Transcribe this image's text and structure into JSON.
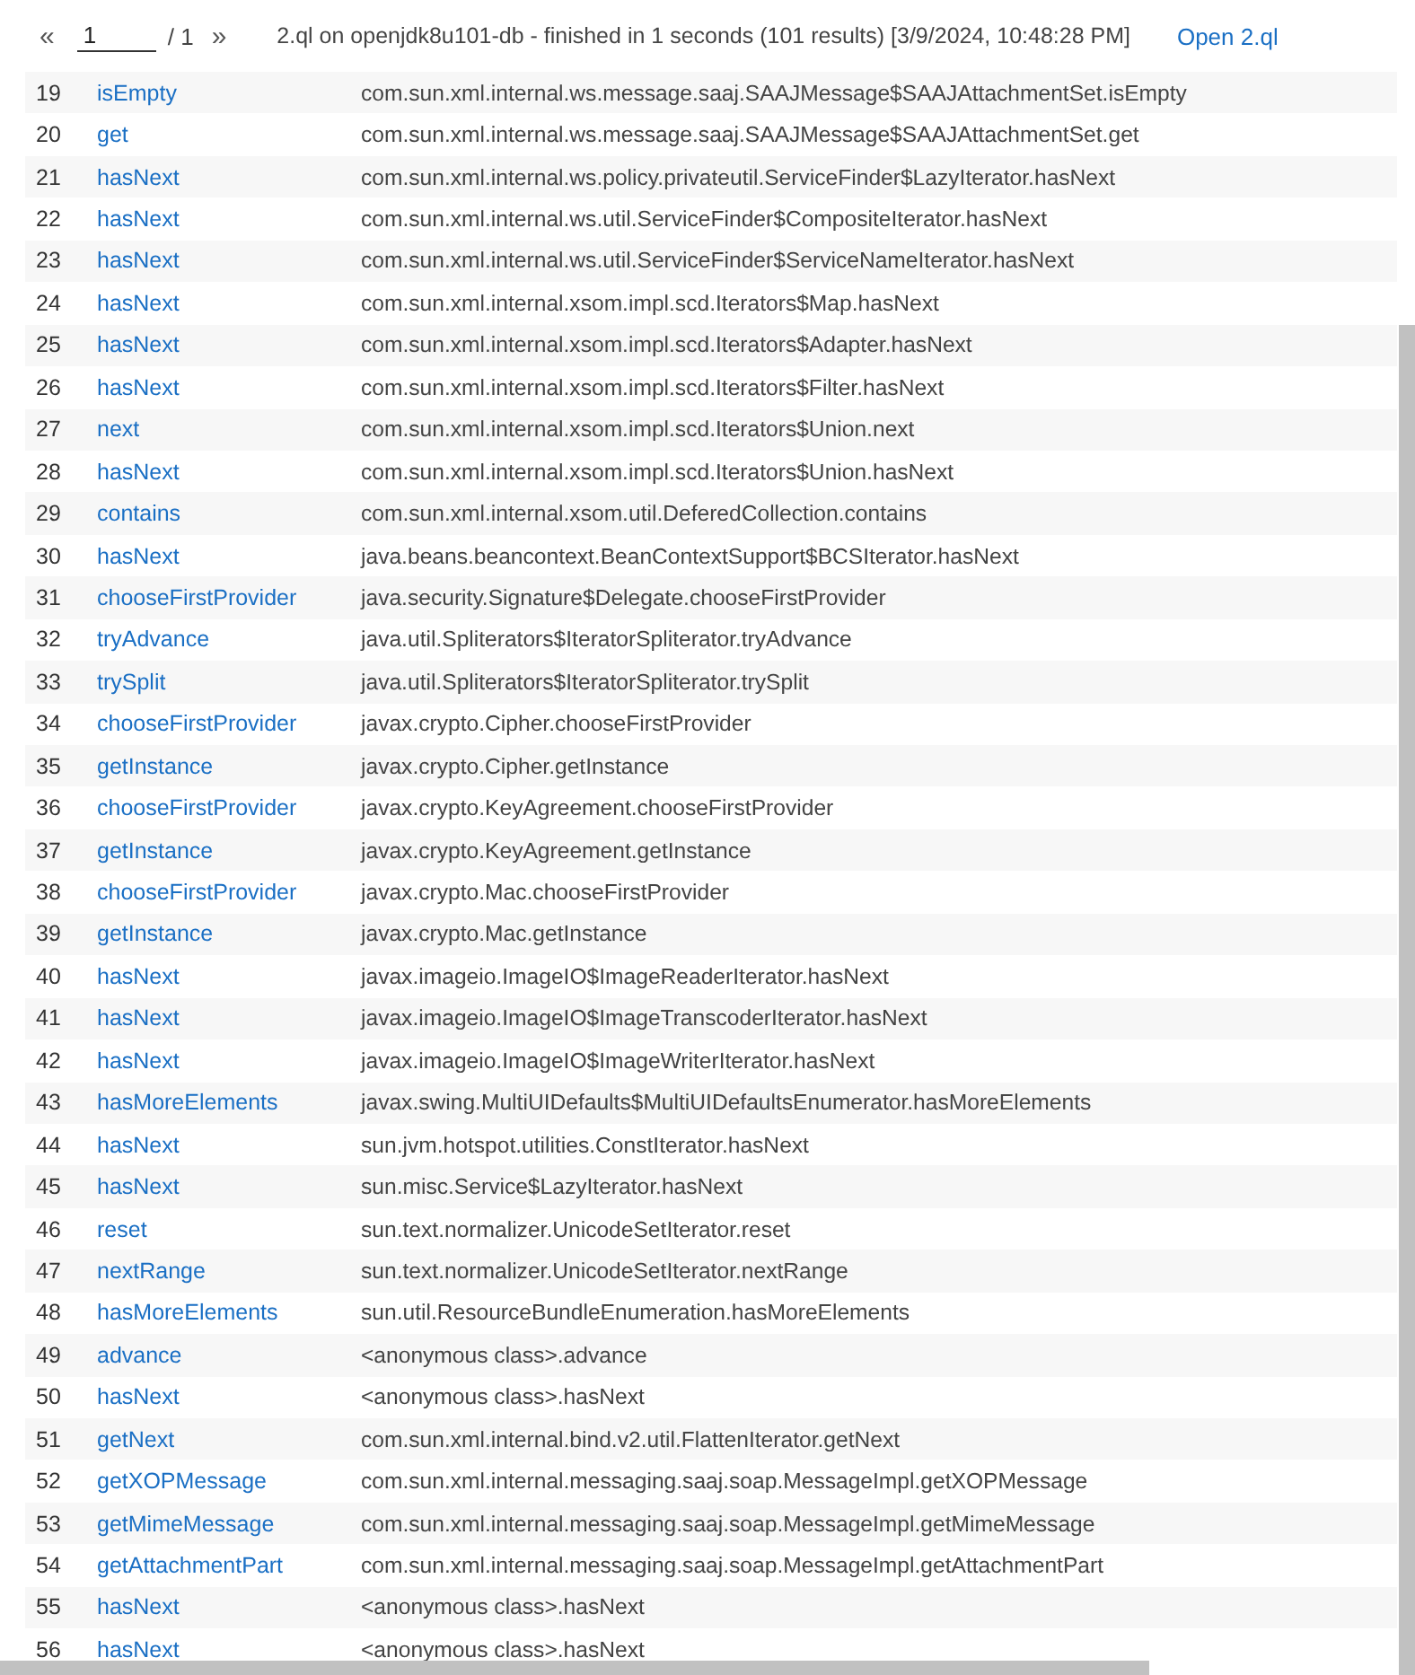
{
  "pager": {
    "prev": "«",
    "page": "1",
    "total": "/ 1",
    "next": "»"
  },
  "summary": "2.ql on openjdk8u101-db - finished in 1 seconds (101 results) [3/9/2024, 10:48:28 PM]",
  "open_link": "Open 2.ql",
  "rows": [
    {
      "index": "19",
      "name": "isEmpty",
      "path": "com.sun.xml.internal.ws.message.saaj.SAAJMessage$SAAJAttachmentSet.isEmpty"
    },
    {
      "index": "20",
      "name": "get",
      "path": "com.sun.xml.internal.ws.message.saaj.SAAJMessage$SAAJAttachmentSet.get"
    },
    {
      "index": "21",
      "name": "hasNext",
      "path": "com.sun.xml.internal.ws.policy.privateutil.ServiceFinder$LazyIterator.hasNext"
    },
    {
      "index": "22",
      "name": "hasNext",
      "path": "com.sun.xml.internal.ws.util.ServiceFinder$CompositeIterator.hasNext"
    },
    {
      "index": "23",
      "name": "hasNext",
      "path": "com.sun.xml.internal.ws.util.ServiceFinder$ServiceNameIterator.hasNext"
    },
    {
      "index": "24",
      "name": "hasNext",
      "path": "com.sun.xml.internal.xsom.impl.scd.Iterators$Map.hasNext"
    },
    {
      "index": "25",
      "name": "hasNext",
      "path": "com.sun.xml.internal.xsom.impl.scd.Iterators$Adapter.hasNext"
    },
    {
      "index": "26",
      "name": "hasNext",
      "path": "com.sun.xml.internal.xsom.impl.scd.Iterators$Filter.hasNext"
    },
    {
      "index": "27",
      "name": "next",
      "path": "com.sun.xml.internal.xsom.impl.scd.Iterators$Union.next"
    },
    {
      "index": "28",
      "name": "hasNext",
      "path": "com.sun.xml.internal.xsom.impl.scd.Iterators$Union.hasNext"
    },
    {
      "index": "29",
      "name": "contains",
      "path": "com.sun.xml.internal.xsom.util.DeferedCollection.contains"
    },
    {
      "index": "30",
      "name": "hasNext",
      "path": "java.beans.beancontext.BeanContextSupport$BCSIterator.hasNext"
    },
    {
      "index": "31",
      "name": "chooseFirstProvider",
      "path": "java.security.Signature$Delegate.chooseFirstProvider"
    },
    {
      "index": "32",
      "name": "tryAdvance",
      "path": "java.util.Spliterators$IteratorSpliterator.tryAdvance"
    },
    {
      "index": "33",
      "name": "trySplit",
      "path": "java.util.Spliterators$IteratorSpliterator.trySplit"
    },
    {
      "index": "34",
      "name": "chooseFirstProvider",
      "path": "javax.crypto.Cipher.chooseFirstProvider"
    },
    {
      "index": "35",
      "name": "getInstance",
      "path": "javax.crypto.Cipher.getInstance"
    },
    {
      "index": "36",
      "name": "chooseFirstProvider",
      "path": "javax.crypto.KeyAgreement.chooseFirstProvider"
    },
    {
      "index": "37",
      "name": "getInstance",
      "path": "javax.crypto.KeyAgreement.getInstance"
    },
    {
      "index": "38",
      "name": "chooseFirstProvider",
      "path": "javax.crypto.Mac.chooseFirstProvider"
    },
    {
      "index": "39",
      "name": "getInstance",
      "path": "javax.crypto.Mac.getInstance"
    },
    {
      "index": "40",
      "name": "hasNext",
      "path": "javax.imageio.ImageIO$ImageReaderIterator.hasNext"
    },
    {
      "index": "41",
      "name": "hasNext",
      "path": "javax.imageio.ImageIO$ImageTranscoderIterator.hasNext"
    },
    {
      "index": "42",
      "name": "hasNext",
      "path": "javax.imageio.ImageIO$ImageWriterIterator.hasNext"
    },
    {
      "index": "43",
      "name": "hasMoreElements",
      "path": "javax.swing.MultiUIDefaults$MultiUIDefaultsEnumerator.hasMoreElements"
    },
    {
      "index": "44",
      "name": "hasNext",
      "path": "sun.jvm.hotspot.utilities.ConstIterator.hasNext"
    },
    {
      "index": "45",
      "name": "hasNext",
      "path": "sun.misc.Service$LazyIterator.hasNext"
    },
    {
      "index": "46",
      "name": "reset",
      "path": "sun.text.normalizer.UnicodeSetIterator.reset"
    },
    {
      "index": "47",
      "name": "nextRange",
      "path": "sun.text.normalizer.UnicodeSetIterator.nextRange"
    },
    {
      "index": "48",
      "name": "hasMoreElements",
      "path": "sun.util.ResourceBundleEnumeration.hasMoreElements"
    },
    {
      "index": "49",
      "name": "advance",
      "path": "<anonymous class>.advance"
    },
    {
      "index": "50",
      "name": "hasNext",
      "path": "<anonymous class>.hasNext"
    },
    {
      "index": "51",
      "name": "getNext",
      "path": "com.sun.xml.internal.bind.v2.util.FlattenIterator.getNext"
    },
    {
      "index": "52",
      "name": "getXOPMessage",
      "path": "com.sun.xml.internal.messaging.saaj.soap.MessageImpl.getXOPMessage"
    },
    {
      "index": "53",
      "name": "getMimeMessage",
      "path": "com.sun.xml.internal.messaging.saaj.soap.MessageImpl.getMimeMessage"
    },
    {
      "index": "54",
      "name": "getAttachmentPart",
      "path": "com.sun.xml.internal.messaging.saaj.soap.MessageImpl.getAttachmentPart"
    },
    {
      "index": "55",
      "name": "hasNext",
      "path": "<anonymous class>.hasNext"
    },
    {
      "index": "56",
      "name": "hasNext",
      "path": "<anonymous class>.hasNext"
    }
  ]
}
